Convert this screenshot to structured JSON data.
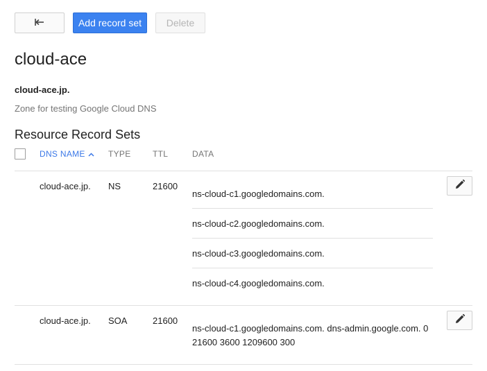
{
  "toolbar": {
    "back_icon": "back-arrow-icon",
    "add_label": "Add record set",
    "delete_label": "Delete"
  },
  "zone": {
    "title": "cloud-ace",
    "dns_name": "cloud-ace.jp.",
    "description": "Zone for testing Google Cloud DNS"
  },
  "section_title": "Resource Record Sets",
  "table": {
    "columns": [
      "DNS NAME",
      "TYPE",
      "TTL",
      "DATA"
    ],
    "sort_icon": "sort-ascending-icon",
    "rows": [
      {
        "dns_name": "cloud-ace.jp.",
        "type": "NS",
        "ttl": "21600",
        "data": [
          "ns-cloud-c1.googledomains.com.",
          "ns-cloud-c2.googledomains.com.",
          "ns-cloud-c3.googledomains.com.",
          "ns-cloud-c4.googledomains.com."
        ]
      },
      {
        "dns_name": "cloud-ace.jp.",
        "type": "SOA",
        "ttl": "21600",
        "data": [
          "ns-cloud-c1.googledomains.com. dns-admin.google.com. 0",
          "21600 3600 1209600 300"
        ]
      }
    ]
  },
  "colors": {
    "accent": "#3b82f0",
    "sort_header": "#3b78e7",
    "divider": "#e0e0e0"
  }
}
